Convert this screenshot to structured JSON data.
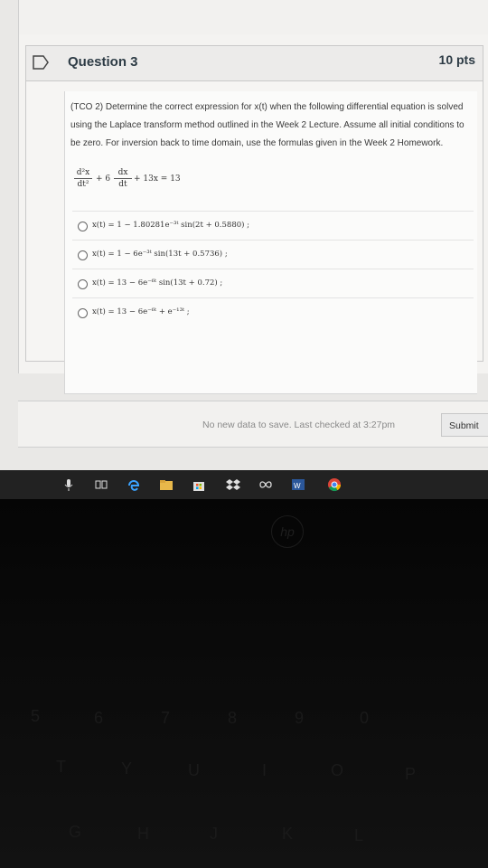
{
  "question": {
    "title": "Question 3",
    "points": "10 pts",
    "text": "(TCO 2) Determine the correct expression for x(t) when the following differential equation is solved using the Laplace transform method outlined in the Week 2 Lecture. Assume all initial conditions to be zero. For inversion back to time domain, use the formulas given in the Week 2 Homework.",
    "equation": {
      "term1_num": "d²x",
      "term1_den": "dt²",
      "coef": "+ 6",
      "term2_num": "dx",
      "term2_den": "dt",
      "rest": "+ 13x = 13"
    },
    "options": [
      "x(t) = 1 − 1.80281e⁻³ᵗ sin(2t + 0.5880) ;",
      "x(t) = 1 − 6e⁻³ᵗ sin(13t + 0.5736) ;",
      "x(t) = 13 − 6e⁻⁶ᵗ sin(13t + 0.72) ;",
      "x(t) = 13 − 6e⁻⁶ᵗ + e⁻¹³ᵗ ;"
    ]
  },
  "footer": {
    "save_status": "No new data to save. Last checked at 3:27pm",
    "submit_label": "Submit"
  },
  "taskbar": {
    "icons": [
      "microphone-icon",
      "task-view-icon",
      "edge-icon",
      "file-explorer-icon",
      "store-icon",
      "dropbox-icon",
      "infinity-icon",
      "word-icon",
      "chrome-icon"
    ]
  },
  "keyboard": {
    "logo": "hp",
    "keys": [
      "5",
      "6",
      "7",
      "8",
      "9",
      "0",
      "T",
      "Y",
      "U",
      "I",
      "O",
      "P",
      "G",
      "H",
      "J",
      "K",
      "L"
    ]
  },
  "colors": {
    "canvas_bg": "#e9e8e6",
    "card_bg": "#f6f5f3",
    "title_text": "#2d3b45",
    "taskbar_bg": "#222222"
  }
}
